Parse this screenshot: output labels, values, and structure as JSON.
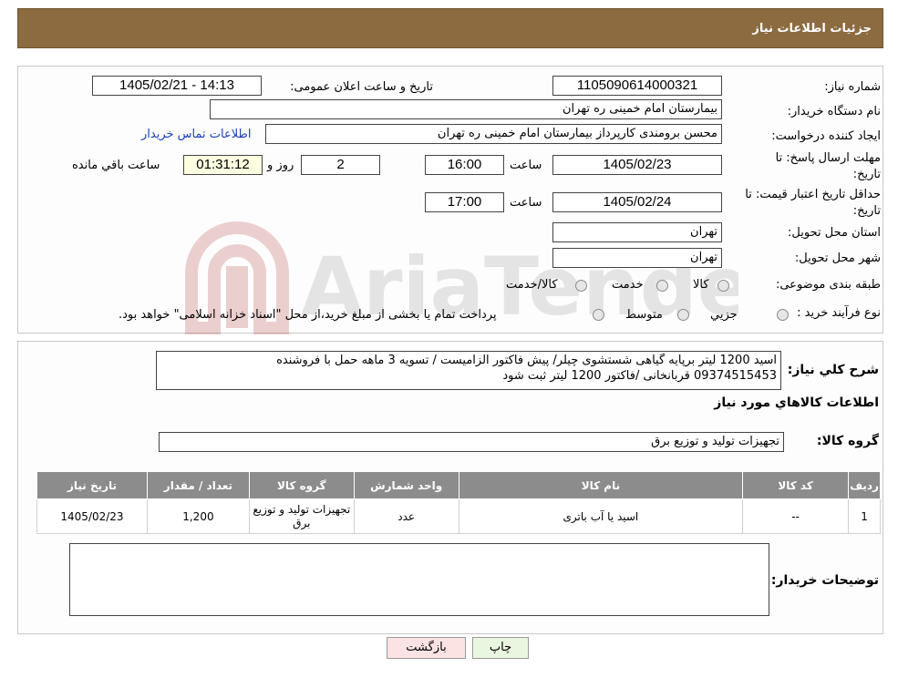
{
  "header": {
    "title": "جزئیات اطلاعات نیاز"
  },
  "form": {
    "need_number_label": "شماره نیاز:",
    "need_number": "1105090614000321",
    "announce_label": "تاریخ و ساعت اعلان عمومی:",
    "announce_value": "1405/02/21 - 14:13",
    "buyer_org_label": "نام دستگاه خریدار:",
    "buyer_org": "بیمارستان امام خمینی ره  تهران",
    "creator_label": "ایجاد کننده درخواست:",
    "creator": "محسن برومندی کارپرداز بیمارستان امام خمینی ره  تهران",
    "contact_link": "اطلاعات تماس خریدار",
    "deadline_label_1": "مهلت ارسال پاسخ: تا",
    "deadline_label_2": "تاریخ:",
    "deadline_date": "1405/02/23",
    "time_label": "ساعت",
    "deadline_time": "16:00",
    "days_value": "2",
    "days_label": "روز و",
    "remaining_time": "01:31:12",
    "remaining_label": "ساعت باقي مانده",
    "validity_label_1": "حداقل تاریخ اعتبار قیمت: تا",
    "validity_label_2": "تاریخ:",
    "validity_date": "1405/02/24",
    "validity_time": "17:00",
    "province_label": "استان محل تحویل:",
    "province": "تهران",
    "city_label": "شهر محل تحویل:",
    "city": "تهران",
    "category_label": "طبقه بندی موضوعی:",
    "category_options": [
      "کالا",
      "خدمت",
      "کالا/خدمت"
    ],
    "purchase_type_label": "نوع فرآیند خرید :",
    "purchase_options": [
      "جزیي",
      "متوسط"
    ],
    "payment_note": "پرداخت تمام یا بخشی از مبلغ خرید،از محل \"اسناد خزانه اسلامی\" خواهد بود."
  },
  "description": {
    "label": "شرح کلي نياز:",
    "line1": "اسید  1200 لیتر برپایه گیاهی شستشوی چیلر/ پیش فاکتور الزامیست / تسویه 3 ماهه حمل با فروشنده",
    "line2": "09374515453 قربانخانی /فاکتور 1200 لیتر ثبت شود"
  },
  "goods": {
    "section_title": "اطلاعات کالاهاي مورد نياز",
    "group_label": "گروه کالا:",
    "group_value": "تجهیزات تولید و توزیع برق",
    "columns": [
      "رديف",
      "کد کالا",
      "نام کالا",
      "واحد شمارش",
      "گروه کالا",
      "تعداد / مقدار",
      "تاریخ نیاز"
    ],
    "rows": [
      [
        "1",
        "--",
        "اسید یا آب باتری",
        "عدد",
        "تجهیزات تولید و توزیع برق",
        "1,200",
        "1405/02/23"
      ]
    ]
  },
  "buyer_notes": {
    "label": "توضیحات خریدار:"
  },
  "buttons": {
    "print": "چاپ",
    "back": "بازگشت"
  },
  "watermark_text": "AriaTender.neT",
  "colors": {
    "header_bg": "#8c6b40",
    "table_header_bg": "#8c8c8c",
    "print_btn": "#eaf7e0",
    "back_btn": "#fbe3e3",
    "link": "#1a3fb8"
  }
}
